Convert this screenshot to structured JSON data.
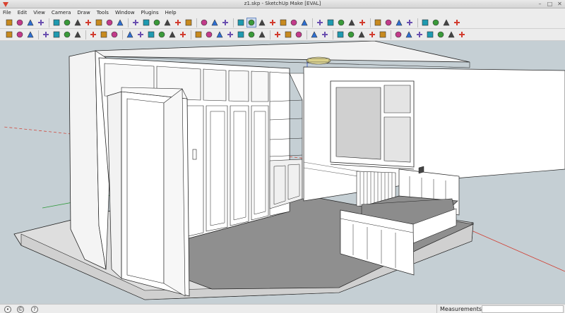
{
  "window": {
    "title": "z1.skp - SketchUp Make [EVAL]"
  },
  "menu": [
    "File",
    "Edit",
    "View",
    "Camera",
    "Draw",
    "Tools",
    "Window",
    "Plugins",
    "Help"
  ],
  "toolbar1": [
    "select-icon",
    "eraser-icon",
    "paint-bucket-icon",
    "ruler-tape-icon",
    "rotate-icon",
    "protractor-icon",
    "line-icon",
    "arc-icon",
    "circle-icon",
    "polygon-icon",
    "freehand-icon",
    "pushpull-icon",
    "move-icon",
    "offset-icon",
    "scale-icon",
    "follow-me-icon",
    "text-icon",
    "dimension-icon",
    "section-icon",
    "axes-icon",
    "orbit-icon",
    "pan-icon",
    "zoom-icon",
    "zoom-window-icon",
    "zoom-extents-icon",
    "previous-view-icon",
    "walk-icon",
    "look-around-icon",
    "position-camera-icon",
    "add-location-icon",
    "terrain-icon",
    "photo-texture-icon",
    "components-icon",
    "warehouse-icon",
    "model-info-icon",
    "styles-icon",
    "share-icon",
    "layer-icon",
    "red-square-icon",
    "ext-warehouse-icon"
  ],
  "toolbar2": [
    "new-icon",
    "open-icon",
    "save-icon",
    "cut-icon",
    "copy-icon",
    "paste-icon",
    "erase-icon",
    "undo-icon",
    "redo-icon",
    "print-icon",
    "iso-view-icon",
    "top-view-icon",
    "front-view-icon",
    "right-view-icon",
    "back-view-icon",
    "left-view-icon",
    "xray-icon",
    "back-edges-icon",
    "wireframe-icon",
    "hidden-line-icon",
    "shaded-icon",
    "shaded-texture-icon",
    "monochrome-icon",
    "house-icon",
    "shadows-icon",
    "fog-icon",
    "section-plane-icon",
    "section-cut-icon",
    "sandbox-icon",
    "stamp-icon",
    "drape-icon",
    "add-detail-icon",
    "flip-edge-icon",
    "solid-union-icon",
    "solid-subtract-icon",
    "outer-shell-icon",
    "solid-trim-icon",
    "intersect-icon",
    "split-icon",
    "solid-tools-icon"
  ],
  "status": {
    "icons": [
      "geo-location-icon",
      "credits-icon",
      "help-icon"
    ],
    "measurements_label": "Measurements",
    "measurements_value": ""
  },
  "colors": {
    "sky": "#c5cfd4",
    "wall": "#ffffff",
    "floor": "#8e8e8e",
    "base_edge": "#d4d4d4",
    "axis_red": "#d23b2e",
    "axis_green": "#2e9a3a",
    "axis_blue": "#3050c8"
  }
}
